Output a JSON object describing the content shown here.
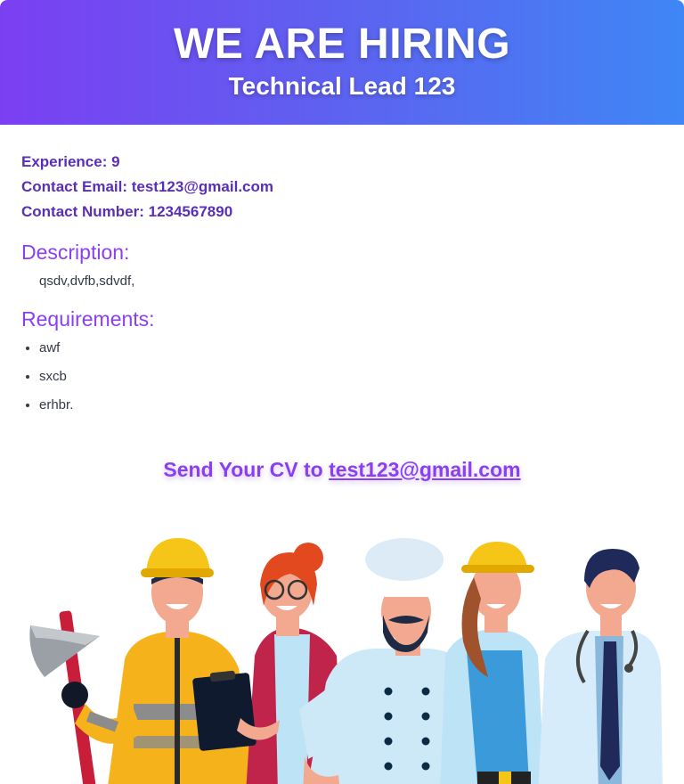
{
  "header": {
    "title": "WE ARE HIRING",
    "subtitle": "Technical Lead 123"
  },
  "info": {
    "experience": "Experience: 9",
    "email": "Contact Email: test123@gmail.com",
    "phone": "Contact Number: 1234567890"
  },
  "description": {
    "heading": "Description:",
    "text": "qsdv,dvfb,sdvdf,"
  },
  "requirements": {
    "heading": "Requirements:",
    "items": [
      "awf",
      "sxcb",
      "erhbr."
    ]
  },
  "cta": {
    "prefix": "Send Your CV to",
    "email": "test123@gmail.com"
  },
  "colors": {
    "gradient_start": "#7b3ff2",
    "gradient_end": "#3f86f6",
    "accent": "#8a3ff0",
    "info_text": "#5b2eb8"
  },
  "illustration": {
    "icon": "workers-group-illustration"
  }
}
